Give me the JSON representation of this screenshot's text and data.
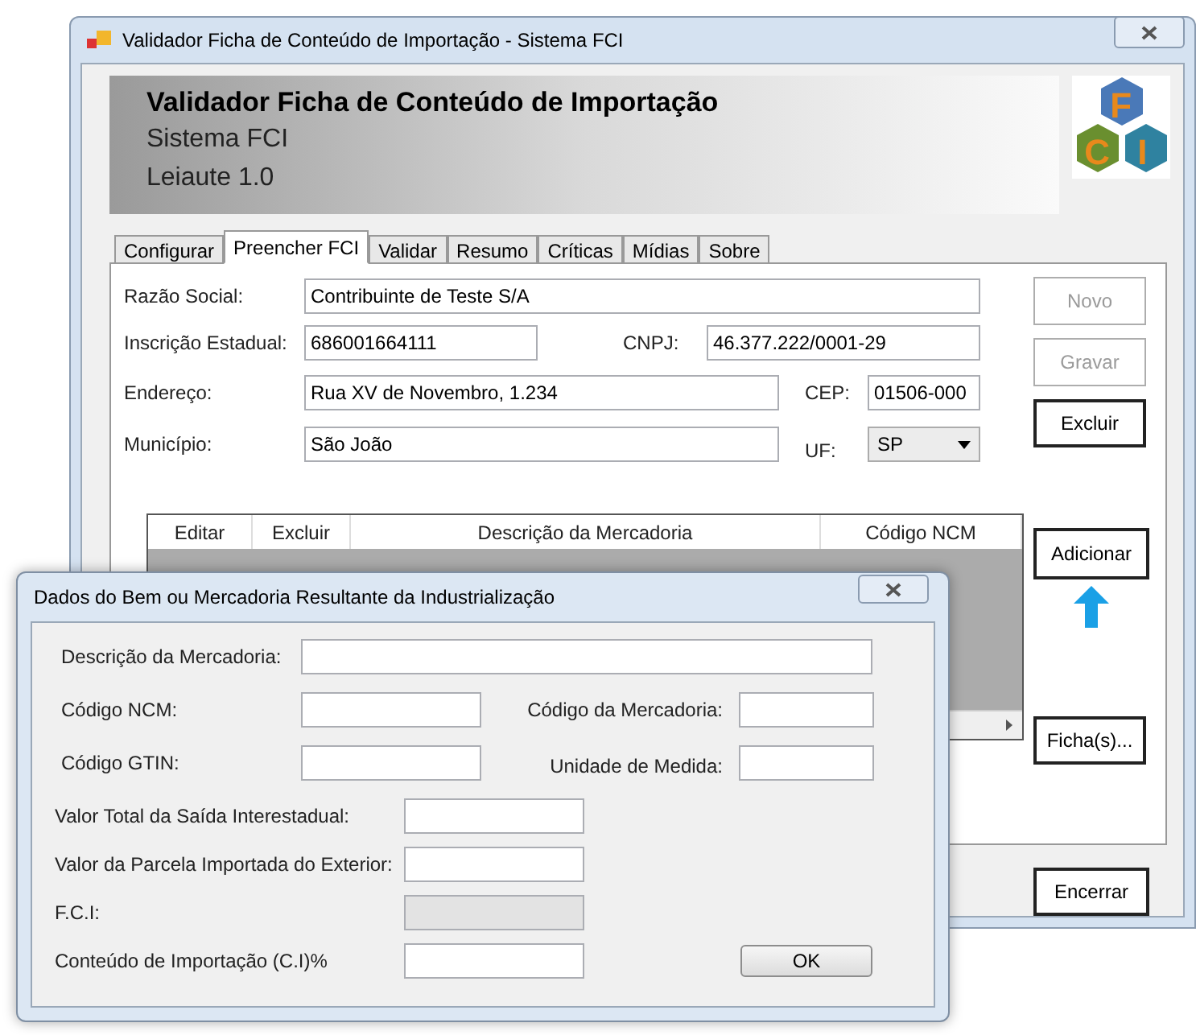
{
  "window": {
    "title": "Validador Ficha de Conteúdo de Importação - Sistema FCI"
  },
  "header": {
    "title": "Validador Ficha de Conteúdo de Importação",
    "subtitle": "Sistema FCI",
    "version": "Leiaute 1.0"
  },
  "logo": {
    "letters": [
      "F",
      "C",
      "I"
    ]
  },
  "tabs": [
    {
      "label": "Configurar",
      "selected": false
    },
    {
      "label": "Preencher FCI",
      "selected": true
    },
    {
      "label": "Validar",
      "selected": false
    },
    {
      "label": "Resumo",
      "selected": false
    },
    {
      "label": "Críticas",
      "selected": false
    },
    {
      "label": "Mídias",
      "selected": false
    },
    {
      "label": "Sobre",
      "selected": false
    }
  ],
  "form": {
    "razao_social": {
      "label": "Razão Social:",
      "value": "Contribuinte de Teste S/A"
    },
    "inscricao_estadual": {
      "label": "Inscrição Estadual:",
      "value": "686001664111"
    },
    "cnpj": {
      "label": "CNPJ:",
      "value": "46.377.222/0001-29"
    },
    "endereco": {
      "label": "Endereço:",
      "value": "Rua XV de Novembro, 1.234"
    },
    "cep": {
      "label": "CEP:",
      "value": "01506-000"
    },
    "municipio": {
      "label": "Município:",
      "value": "São João"
    },
    "uf": {
      "label": "UF:",
      "value": "SP"
    }
  },
  "side_buttons": [
    {
      "label": "Novo",
      "disabled": true
    },
    {
      "label": "Gravar",
      "disabled": true
    },
    {
      "label": "Excluir",
      "disabled": false
    }
  ],
  "grid": {
    "columns": [
      "Editar",
      "Excluir",
      "Descrição da Mercadoria",
      "Código NCM"
    ]
  },
  "add_button": {
    "label": "Adicionar"
  },
  "fichas_button": {
    "label": "Ficha(s)..."
  },
  "close_button": {
    "label": "Encerrar"
  },
  "dialog": {
    "title": "Dados do Bem ou Mercadoria Resultante da Industrialização",
    "descricao": {
      "label": "Descrição da Mercadoria:"
    },
    "ncm": {
      "label": "Código NCM:"
    },
    "codigo": {
      "label": "Código da Mercadoria:"
    },
    "gtin": {
      "label": "Código GTIN:"
    },
    "unidade": {
      "label": "Unidade de Medida:"
    },
    "valores": [
      {
        "label": "Valor Total da Saída Interestadual:",
        "disabled": false
      },
      {
        "label": "Valor da Parcela Importada do Exterior:",
        "disabled": false
      },
      {
        "label": "F.C.I:",
        "disabled": true
      },
      {
        "label": "Conteúdo de Importação (C.I)%",
        "disabled": false
      }
    ],
    "ok": "OK"
  }
}
